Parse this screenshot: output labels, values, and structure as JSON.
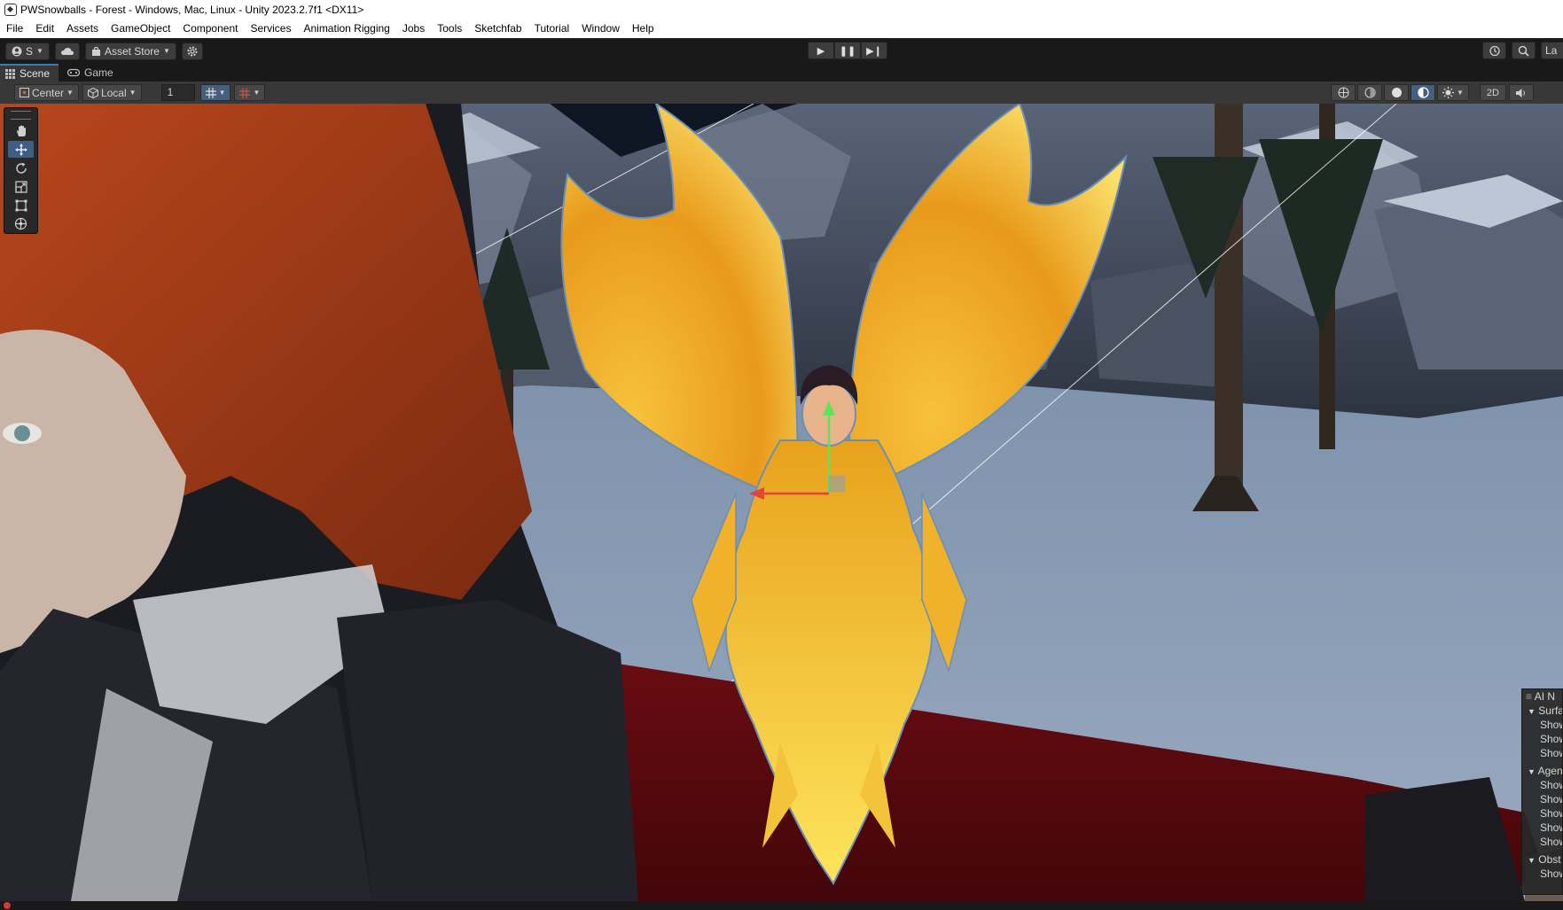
{
  "window": {
    "title": "PWSnowballs - Forest - Windows, Mac, Linux - Unity 2023.2.7f1 <DX11>"
  },
  "menu": [
    "File",
    "Edit",
    "Assets",
    "GameObject",
    "Component",
    "Services",
    "Animation Rigging",
    "Jobs",
    "Tools",
    "Sketchfab",
    "Tutorial",
    "Window",
    "Help"
  ],
  "toolbar": {
    "account_label": "S",
    "asset_store_label": "Asset Store",
    "layers_label": "La"
  },
  "tabs": {
    "scene": "Scene",
    "game": "Game"
  },
  "scene_toolbar": {
    "pivot": "Center",
    "space": "Local",
    "increment": "1",
    "mode_2d": "2D"
  },
  "overlay": {
    "title": "AI N",
    "rows": [
      "Surfa",
      "Show",
      "Show",
      "Show",
      "Agen",
      "Show",
      "Show",
      "Show",
      "Show",
      "Show",
      "Obst",
      "Show"
    ]
  },
  "status": {
    "message": ""
  },
  "icons": [
    "unity-logo-icon",
    "account-icon",
    "cloud-icon",
    "bag-icon",
    "gear-icon",
    "play-icon",
    "pause-icon",
    "step-icon",
    "history-icon",
    "search-icon",
    "scene-icon",
    "gamepad-icon",
    "hand-icon",
    "move-icon",
    "rotate-icon",
    "scale-icon",
    "rect-icon",
    "transform-icon",
    "grid-icon",
    "snap-icon",
    "globe-icon",
    "shading-icon",
    "sun-icon",
    "gizmo-icon",
    "audio-icon"
  ],
  "colors": {
    "accent": "#3a79bb",
    "selected": "#3d5f87",
    "error": "#d13a3a"
  }
}
